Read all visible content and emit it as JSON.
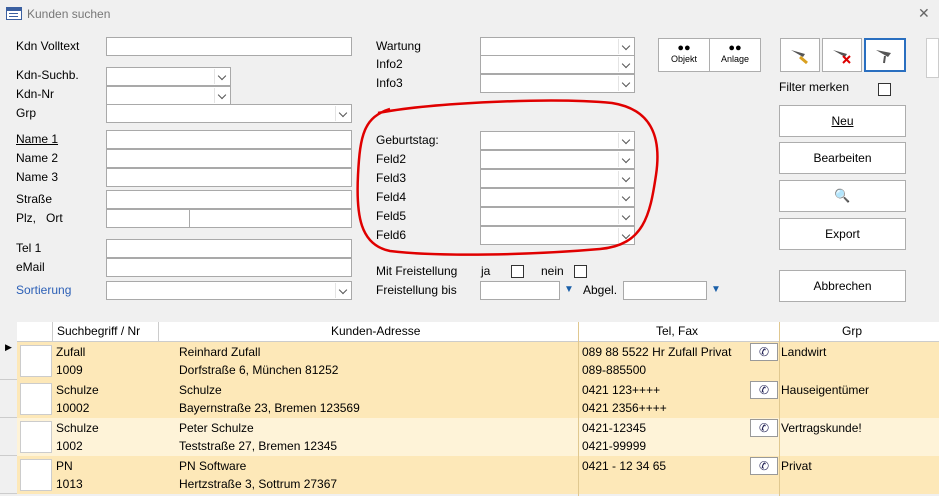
{
  "window": {
    "title": "Kunden suchen",
    "close_glyph": "✕"
  },
  "form": {
    "kdn_volltext": "Kdn Volltext",
    "kdn_suchb": "Kdn-Suchb.",
    "kdn_nr": "Kdn-Nr",
    "grp": "Grp",
    "name1": "Name 1",
    "name2": "Name 2",
    "name3": "Name 3",
    "strasse": "Straße",
    "plz": "Plz,",
    "ort": "Ort",
    "tel1": "Tel 1",
    "email": "eMail",
    "sortierung": "Sortierung",
    "wartung": "Wartung",
    "info2": "Info2",
    "info3": "Info3",
    "geburtstag": "Geburtstag:",
    "feld2": "Feld2",
    "feld3": "Feld3",
    "feld4": "Feld4",
    "feld5": "Feld5",
    "feld6": "Feld6",
    "mit_freistellung": "Mit Freistellung",
    "ja": "ja",
    "nein": "nein",
    "freistellung_bis": "Freistellung bis",
    "abgel": "Abgel."
  },
  "buttons": {
    "objekt": "Objekt",
    "anlage": "Anlage",
    "filter_merken": "Filter merken",
    "neu": "Neu",
    "bearbeiten": "Bearbeiten",
    "export": "Export",
    "abbrechen": "Abbrechen"
  },
  "table": {
    "headers": [
      "Suchbegriff /  Nr",
      "Kunden-Adresse",
      "Tel, Fax",
      "Grp"
    ],
    "rows": [
      {
        "such": "Zufall",
        "nr": "1009",
        "name": "Reinhard Zufall",
        "addr": "Dorfstraße 6, München 81252",
        "tel": "089 88 5522 Hr Zufall Privat",
        "fax": "089-885500",
        "grp": "Landwirt"
      },
      {
        "such": "Schulze",
        "nr": "10002",
        "name": "Schulze",
        "addr": "Bayernstraße 23, Bremen 123569",
        "tel": "0421 123++++",
        "fax": "0421 2356++++",
        "grp": "Hauseigentümer"
      },
      {
        "such": "Schulze",
        "nr": "1002",
        "name": "Peter Schulze",
        "addr": "Teststraße 27, Bremen 12345",
        "tel": "0421-12345",
        "fax": "0421-99999",
        "grp": "Vertragskunde!"
      },
      {
        "such": "PN",
        "nr": "1013",
        "name": "PN Software",
        "addr": "Hertzstraße 3, Sottrum 27367",
        "tel": "0421 - 12 34 65",
        "fax": "",
        "grp": "Privat"
      }
    ]
  },
  "colors": {
    "row_odd": "#fde8b8",
    "row_even": "#fef3d8",
    "annotation": "#e00000",
    "link": "#2b5fb6"
  }
}
